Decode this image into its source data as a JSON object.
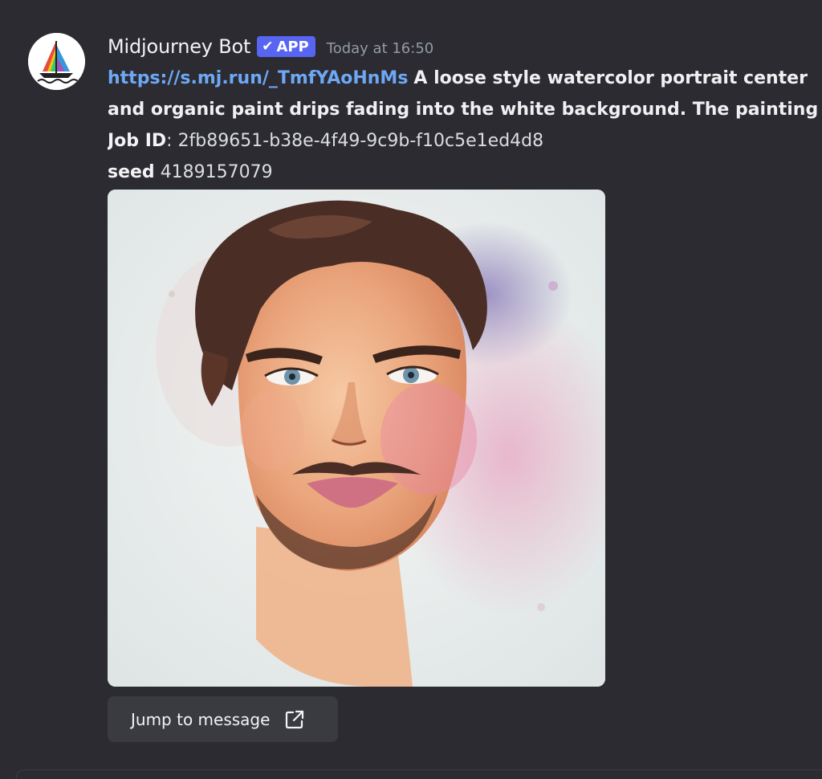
{
  "message": {
    "author": "Midjourney Bot",
    "badge": "APP",
    "badge_icon": "checkmark-icon",
    "timestamp": "Today at 16:50",
    "link_text": "https://s.mj.run/_TmfYAoHnMs",
    "prompt_line1": "A loose style watercolor portrait center",
    "prompt_line2": "and organic paint drips fading into the white background. The painting is",
    "job_id_label": "Job ID",
    "job_id_sep": ": ",
    "job_id_value": "2fb89651-b38e-4f49-9c9b-f10c5e1ed4d8",
    "seed_label": "seed",
    "seed_value": "4189157079"
  },
  "attachment": {
    "description": "watercolor-portrait-image"
  },
  "actions": {
    "jump_label": "Jump to message",
    "jump_icon": "external-link-icon"
  },
  "colors": {
    "background": "#2b2b31",
    "link": "#6ea8f5",
    "badge": "#5865f2",
    "button": "#3a3b41"
  }
}
